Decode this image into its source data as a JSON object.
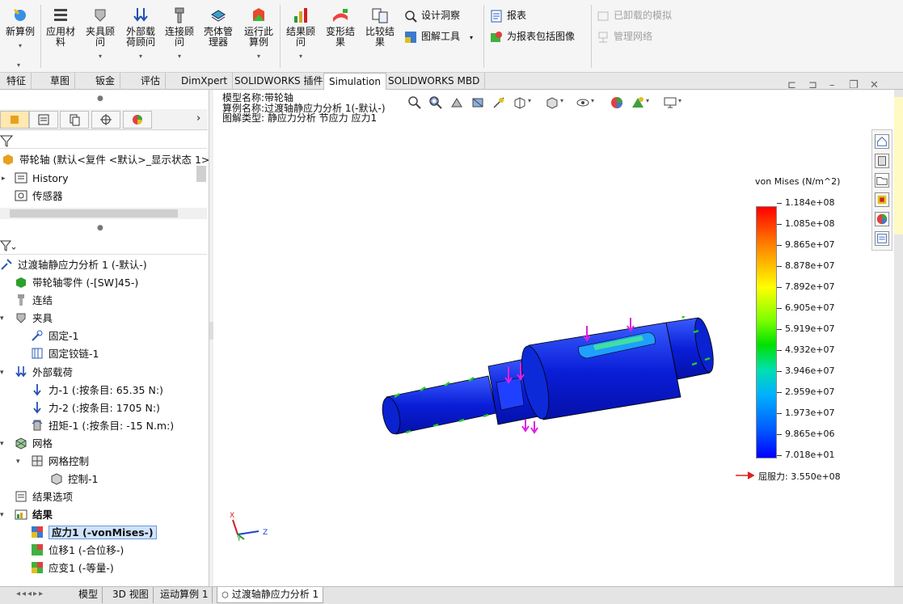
{
  "ribbon": {
    "new_study": "新算例",
    "apply_material": "应用材料",
    "fixtures_advisor": "夹具顾问",
    "external_loads_advisor": "外部载荷顾问",
    "connections_advisor": "连接顾问",
    "shell_manager": "壳体管理器",
    "run_study": "运行此算例",
    "results_advisor": "结果顾问",
    "deformed_result": "变形结果",
    "compare_results": "比较结果",
    "design_insight": "设计洞察",
    "plot_tools": "图解工具",
    "report": "报表",
    "include_image_report": "为报表包括图像",
    "unloaded_sims": "已卸载的模拟",
    "manage_network": "管理网络"
  },
  "tabs": [
    "特征",
    "草图",
    "钣金",
    "评估",
    "DimXpert",
    "SOLIDWORKS 插件",
    "Simulation",
    "SOLIDWORKS MBD"
  ],
  "active_tab": "Simulation",
  "feature_tree": {
    "root": "带轮轴 (默认<复件 <默认>_显示状态 1>",
    "history": "History",
    "sensors": "传感器"
  },
  "study_tree": {
    "study": "过渡轴静应力分析 1 (-默认-)",
    "part": "带轮轴零件 (-[SW]45-)",
    "connections": "连结",
    "fixtures": "夹具",
    "fixed1": "固定-1",
    "fixed_hinge1": "固定铰链-1",
    "ext_loads": "外部载荷",
    "force1": "力-1 (:按条目: 65.35 N:)",
    "force2": "力-2 (:按条目: 1705 N:)",
    "torque1": "扭矩-1 (:按条目: -15 N.m:)",
    "mesh": "网格",
    "mesh_control": "网格控制",
    "control1": "控制-1",
    "result_options": "结果选项",
    "results": "结果",
    "stress1": "应力1 (-vonMises-)",
    "disp1": "位移1 (-合位移-)",
    "strain1": "应变1 (-等量-)"
  },
  "viewport": {
    "model_name": "模型名称:带轮轴",
    "study_name": "算例名称:过渡轴静应力分析 1(-默认-)",
    "plot_type": "图解类型: 静应力分析 节应力 应力1"
  },
  "legend": {
    "title": "von Mises (N/m^2)",
    "labels": [
      "1.184e+08",
      "1.085e+08",
      "9.865e+07",
      "8.878e+07",
      "7.892e+07",
      "6.905e+07",
      "5.919e+07",
      "4.932e+07",
      "3.946e+07",
      "2.959e+07",
      "1.973e+07",
      "9.865e+06",
      "7.018e+01"
    ],
    "yield": "屈服力: 3.550e+08"
  },
  "triad": {
    "x": "X",
    "y": "Y",
    "z": "Z"
  },
  "bottom_tabs": [
    "模型",
    "3D 视图",
    "运动算例 1",
    "过渡轴静应力分析 1"
  ],
  "active_bottom_tab": "过渡轴静应力分析 1"
}
